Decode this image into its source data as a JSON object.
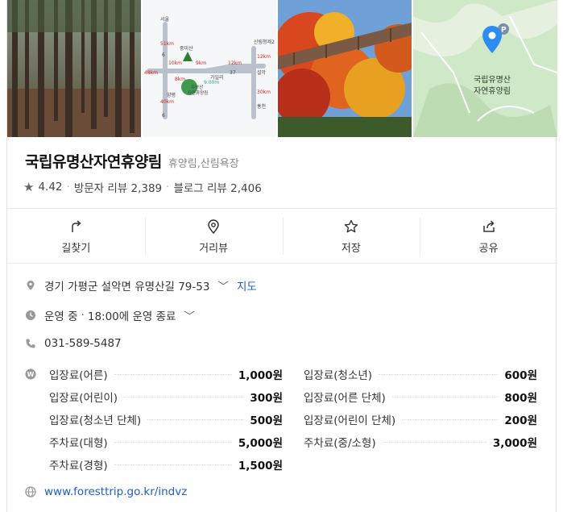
{
  "place": {
    "name": "국립유명산자연휴양림",
    "category": "휴양림,산림욕장",
    "rating": "4.42",
    "visitor_reviews": "방문자 리뷰 2,389",
    "blog_reviews": "블로그 리뷰 2,406"
  },
  "photos": {
    "map_photo": {
      "labels": [
        "서울",
        "51km",
        "중미산",
        "10km",
        "9km",
        "12km",
        "37",
        "가일리",
        "6",
        "6",
        "산림청제2",
        "12km",
        "설악",
        "30km",
        "홍천",
        "양평",
        "48km",
        "40km",
        "8km",
        "유명산",
        "자연휴양림",
        "9.00m"
      ]
    },
    "map_tile": {
      "label_line1": "국립유명산",
      "label_line2": "자연휴양림",
      "parking_label": "P"
    }
  },
  "actions": [
    {
      "label": "길찾기",
      "icon": "directions-icon"
    },
    {
      "label": "거리뷰",
      "icon": "street-view-icon"
    },
    {
      "label": "저장",
      "icon": "star-icon"
    },
    {
      "label": "공유",
      "icon": "share-icon"
    }
  ],
  "info": {
    "address": "경기 가평군 설악면 유명산길 79-53",
    "map_link": "지도",
    "status": "운영 중",
    "status_detail": "18:00에 운영 종료",
    "phone": "031-589-5487",
    "website": "www.foresttrip.go.kr/indvz"
  },
  "fees": [
    {
      "name": "입장료(어른)",
      "value": "1,000원"
    },
    {
      "name": "입장료(청소년)",
      "value": "600원"
    },
    {
      "name": "입장료(어린이)",
      "value": "300원"
    },
    {
      "name": "입장료(어른 단체)",
      "value": "800원"
    },
    {
      "name": "입장료(청소년 단체)",
      "value": "500원"
    },
    {
      "name": "입장료(어린이 단체)",
      "value": "200원"
    },
    {
      "name": "주차료(대형)",
      "value": "5,000원"
    },
    {
      "name": "주차료(중/소형)",
      "value": "3,000원"
    },
    {
      "name": "주차료(경형)",
      "value": "1,500원"
    }
  ],
  "colors": {
    "link": "#1a5fc7",
    "map_pin": "#2d8cf0",
    "map_green": "#cfe8c8"
  }
}
